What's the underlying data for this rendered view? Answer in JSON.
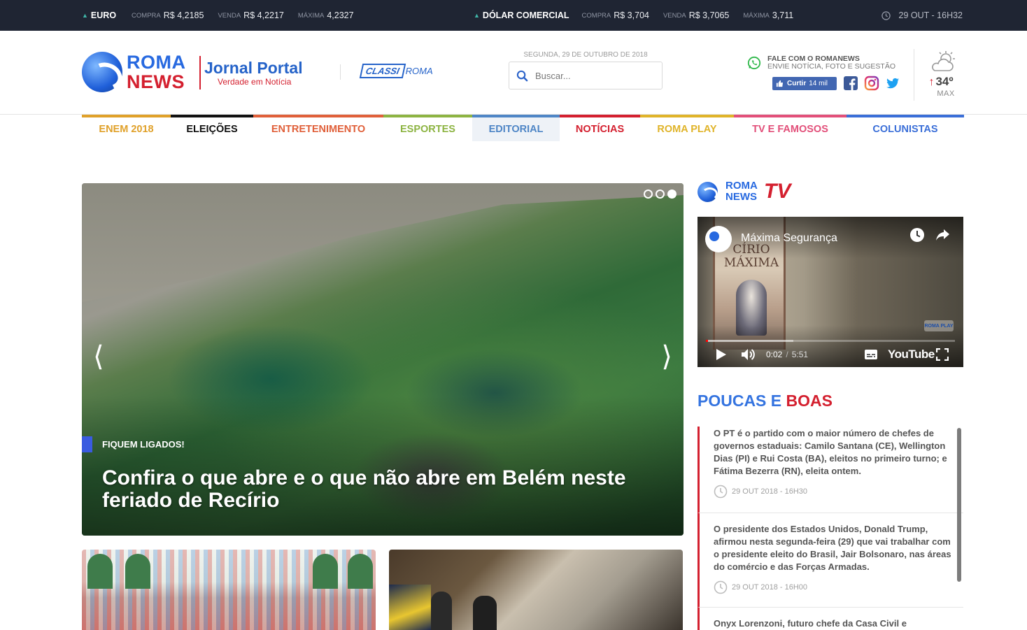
{
  "topbar": {
    "euro": {
      "name": "EURO",
      "compra_label": "COMPRA",
      "compra": "R$ 4,2185",
      "venda_label": "VENDA",
      "venda": "R$ 4,2217",
      "maxima_label": "MÁXIMA",
      "maxima": "4,2327"
    },
    "dolar": {
      "name": "DÓLAR COMERCIAL",
      "compra_label": "COMPRA",
      "compra": "R$ 3,704",
      "venda_label": "VENDA",
      "venda": "R$ 3,7065",
      "maxima_label": "MÁXIMA",
      "maxima": "3,711"
    },
    "datetime": "29 OUT - 16H32"
  },
  "header": {
    "logo_roma": "ROMA",
    "logo_news": "NEWS",
    "jornal_title": "Jornal Portal",
    "jornal_sub": "Verdade em Notícia",
    "classi_a": "CLASSI",
    "classi_b": "ROMA",
    "date": "SEGUNDA, 29 DE OUTUBRO DE 2018",
    "search_placeholder": "Buscar...",
    "fale_title": "FALE COM O ROMANEWS",
    "fale_sub": "ENVIE NOTÍCIA, FOTO E SUGESTÃO",
    "like_label": "Curtir",
    "like_count": "14 mil",
    "weather_temp": "34º",
    "weather_max": "MAX"
  },
  "nav": [
    {
      "label": "ENEM 2018",
      "color": "#e0a12a"
    },
    {
      "label": "ELEIÇÕES",
      "color": "#111111"
    },
    {
      "label": "ENTRETENIMENTO",
      "color": "#e0603a"
    },
    {
      "label": "ESPORTES",
      "color": "#8db443"
    },
    {
      "label": "EDITORIAL",
      "color": "#4f86c6"
    },
    {
      "label": "NOTÍCIAS",
      "color": "#d4202f"
    },
    {
      "label": "ROMA PLAY",
      "color": "#e0b42a"
    },
    {
      "label": "TV E FAMOSOS",
      "color": "#e2507a"
    },
    {
      "label": "COLUNISTAS",
      "color": "#3b6fd8"
    }
  ],
  "hero": {
    "kicker": "FIQUEM LIGADOS!",
    "headline": "Confira o que abre e o que não abre em Belém neste feriado de Recírio",
    "prev": "⟨",
    "next": "⟩"
  },
  "tv": {
    "logo_roma": "ROMA",
    "logo_news": "NEWS",
    "logo_tv": "TV",
    "video_title": "Máxima Segurança",
    "poster_text": "CÍRIO MÁXIMA",
    "watermark": "ROMA PLAY",
    "time_current": "0:02",
    "time_total": "5:51",
    "youtube": "YouTube",
    "progress": 0.006
  },
  "poucas": {
    "title_a": "POUCAS E",
    "title_b": "BOAS",
    "items": [
      {
        "text": "O PT é o partido com o maior número de chefes de governos estaduais: Camilo Santana (CE), Wellington Dias (PI) e Rui Costa (BA), eleitos no primeiro turno; e Fátima Bezerra (RN), eleita ontem.",
        "time": "29 OUT 2018 - 16H30"
      },
      {
        "text": "O presidente dos Estados Unidos, Donald Trump, afirmou nesta segunda-feira (29) que vai trabalhar com o presidente eleito do Brasil, Jair Bolsonaro, nas áreas do comércio e das Forças Armadas.",
        "time": "29 OUT 2018 - 16H00"
      },
      {
        "text": "Onyx Lorenzoni, futuro chefe da Casa Civil e",
        "time": ""
      }
    ]
  }
}
